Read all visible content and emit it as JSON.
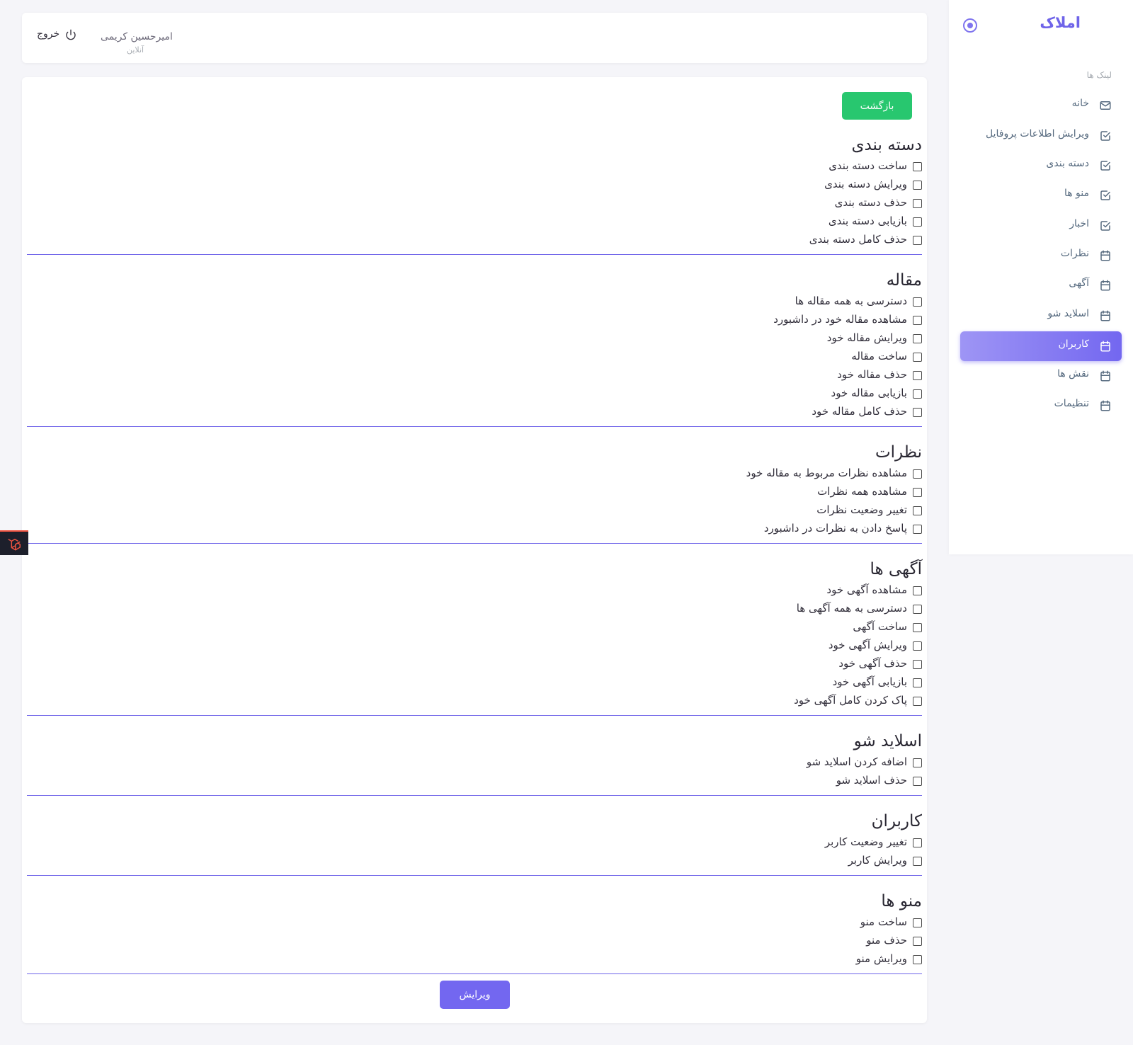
{
  "sidebar": {
    "brand": "املاک",
    "menu_header": "لینک ها",
    "items": [
      {
        "label": "خانه",
        "icon": "mail-icon",
        "active": false
      },
      {
        "label": "ویرایش اطلاعات پروفایل",
        "icon": "checkbox-icon",
        "active": false
      },
      {
        "label": "دسته بندی",
        "icon": "checkbox-icon",
        "active": false
      },
      {
        "label": "منو ها",
        "icon": "checkbox-icon",
        "active": false
      },
      {
        "label": "اخبار",
        "icon": "checkbox-icon",
        "active": false
      },
      {
        "label": "نظرات",
        "icon": "calendar-icon",
        "active": false
      },
      {
        "label": "آگهی",
        "icon": "calendar-icon",
        "active": false
      },
      {
        "label": "اسلاید شو",
        "icon": "calendar-icon",
        "active": false
      },
      {
        "label": "کاربران",
        "icon": "calendar-icon",
        "active": true
      },
      {
        "label": "نقش ها",
        "icon": "calendar-icon",
        "active": false
      },
      {
        "label": "تنظیمات",
        "icon": "calendar-icon",
        "active": false
      }
    ]
  },
  "navbar": {
    "user_name": "امیرحسین کریمی",
    "user_status": "آنلاین",
    "logout_label": "خروج"
  },
  "main": {
    "back_label": "بازگشت",
    "submit_label": "ویرایش",
    "groups": [
      {
        "title": "دسته بندی",
        "permissions": [
          "ساخت دسته بندی",
          "ویرایش دسته بندی",
          "حذف دسته بندی",
          "بازیابی دسته بندی",
          "حذف کامل دسته بندی"
        ]
      },
      {
        "title": "مقاله",
        "permissions": [
          "دسترسی به همه مقاله ها",
          "مشاهده مقاله خود در داشبورد",
          "ویرایش مقاله خود",
          "ساخت مقاله",
          "حذف مقاله خود",
          "بازیابی مقاله خود",
          "حذف کامل مقاله خود"
        ]
      },
      {
        "title": "نظرات",
        "permissions": [
          "مشاهده نظرات مربوط به مقاله خود",
          "مشاهده همه نظرات",
          "تغییر وضعیت نظرات",
          "پاسخ دادن به نظرات در داشبورد"
        ]
      },
      {
        "title": "آگهی ها",
        "permissions": [
          "مشاهده آگهی خود",
          "دسترسی به همه آگهی ها",
          "ساخت آگهی",
          "ویرایش آگهی خود",
          "حذف آگهی خود",
          "بازیابی آگهی خود",
          "پاک کردن کامل آگهی خود"
        ]
      },
      {
        "title": "اسلاید شو",
        "permissions": [
          "اضافه کردن اسلاید شو",
          "حذف اسلاید شو"
        ]
      },
      {
        "title": "کاربران",
        "permissions": [
          "تغییر وضعیت کاربر",
          "ویرایش کاربر"
        ]
      },
      {
        "title": "منو ها",
        "permissions": [
          "ساخت منو",
          "حذف منو",
          "ویرایش منو"
        ]
      }
    ]
  },
  "colors": {
    "accent": "#7367f0",
    "success": "#28c76f",
    "divider": "#6f64e9"
  }
}
